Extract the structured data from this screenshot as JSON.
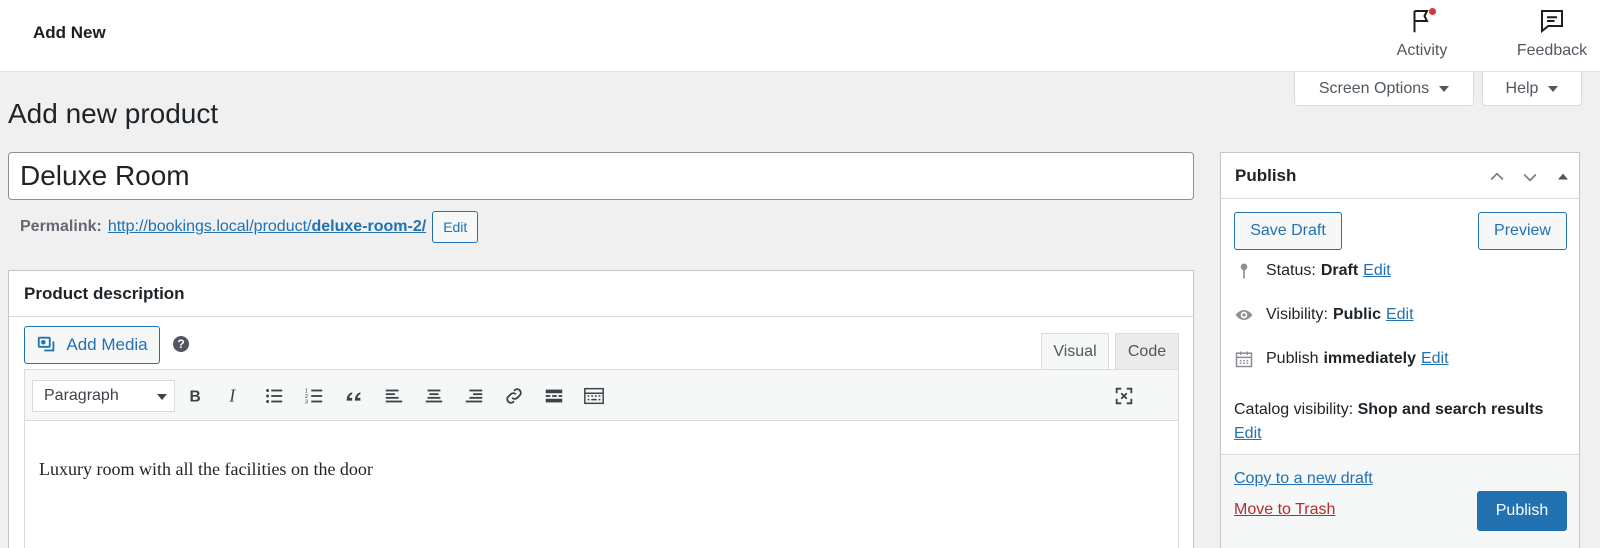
{
  "topbar": {
    "breadcrumb": "Add New",
    "activity_label": "Activity",
    "feedback_label": "Feedback"
  },
  "screen_tabs": {
    "screen_options": "Screen Options",
    "help": "Help"
  },
  "page": {
    "title": "Add new product",
    "product_title_value": "Deluxe Room",
    "permalink_label": "Permalink:",
    "permalink_base": "http://bookings.local/product/",
    "permalink_slug": "deluxe-room-2/",
    "permalink_edit": "Edit"
  },
  "description": {
    "heading": "Product description",
    "add_media": "Add Media",
    "help_glyph": "?",
    "tab_visual": "Visual",
    "tab_code": "Code",
    "format_select": "Paragraph",
    "content": "Luxury room with all the facilities on the door",
    "toolbar_icons": [
      "bold-icon",
      "italic-icon",
      "bullet-list-icon",
      "numbered-list-icon",
      "blockquote-icon",
      "align-left-icon",
      "align-center-icon",
      "align-right-icon",
      "link-icon",
      "read-more-icon",
      "toolbar-toggle-icon",
      "fullscreen-icon"
    ]
  },
  "publish": {
    "heading": "Publish",
    "save_draft": "Save Draft",
    "preview": "Preview",
    "status_label": "Status:",
    "status_value": "Draft",
    "visibility_label": "Visibility:",
    "visibility_value": "Public",
    "publish_label": "Publish",
    "publish_value": "immediately",
    "edit": "Edit",
    "catalog_label": "Catalog visibility:",
    "catalog_value": "Shop and search results",
    "copy_draft": "Copy to a new draft",
    "move_trash": "Move to Trash",
    "publish_button": "Publish"
  },
  "colors": {
    "accent": "#2271b1",
    "danger": "#b32d2e",
    "background": "#f0f0f1"
  }
}
